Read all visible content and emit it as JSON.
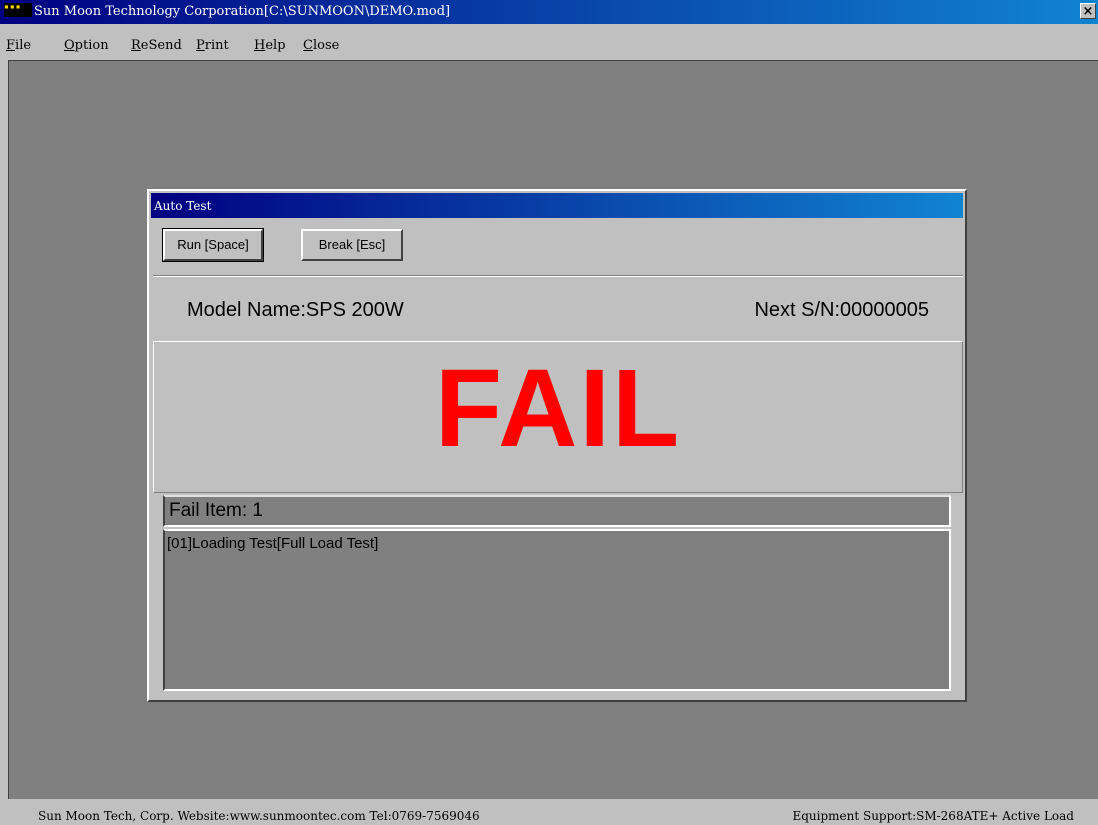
{
  "window": {
    "title": "Sun Moon Technology Corporation[C:\\SUNMOON\\DEMO.mod]",
    "icon": "sun-moon-app-icon",
    "close_label": "×"
  },
  "menu": {
    "items": [
      "File",
      "Option",
      "ReSend",
      "Print",
      "Help",
      "Close"
    ]
  },
  "dialog": {
    "title": "Auto Test",
    "run_button": "Run [Space]",
    "break_button": "Break [Esc]",
    "model_name": "Model Name:SPS 200W",
    "next_sn": "Next S/N:00000005",
    "result": "FAIL",
    "result_color": "#ff0000",
    "fail_header": "Fail Item: 1",
    "fail_items": [
      "[01]Loading Test[Full Load Test]"
    ]
  },
  "statusbar": {
    "left": "Sun Moon Tech, Corp. Website:www.sunmoontec.com Tel:0769-7569046",
    "right": "Equipment Support:SM-268ATE+ Active Load"
  }
}
